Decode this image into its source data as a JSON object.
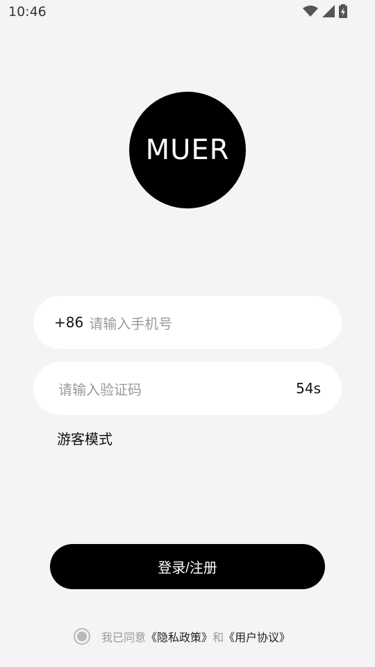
{
  "status_bar": {
    "time": "10:46"
  },
  "logo": {
    "text": "MUER"
  },
  "phone_field": {
    "prefix": "+86",
    "placeholder": "请输入手机号"
  },
  "code_field": {
    "placeholder": "请输入验证码",
    "countdown": "54s"
  },
  "guest_mode": {
    "label": "游客模式"
  },
  "login_button": {
    "label": "登录/注册"
  },
  "agreement": {
    "prefix": "我已同意",
    "privacy_link": "《隐私政策》",
    "conjunction": "和",
    "user_link": "《用户协议》"
  },
  "colors": {
    "background": "#f4f4f6",
    "primary": "#000000",
    "field_bg": "#ffffff",
    "placeholder": "#9a9a9a"
  }
}
